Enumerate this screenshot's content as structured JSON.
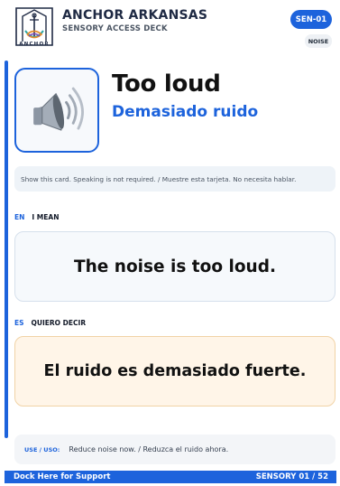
{
  "header": {
    "logo_text": "ANCHOR",
    "brand": "ANCHOR ARKANSAS",
    "deck": "SENSORY ACCESS DECK",
    "code": "SEN-01",
    "category": "NOISE"
  },
  "hero": {
    "icon": "speaker-loud-icon",
    "title": "Too loud",
    "subtitle": "Demasiado ruido"
  },
  "notice": "Show this card. Speaking is not required. / Muestre esta tarjeta. No necesita hablar.",
  "english": {
    "code": "EN",
    "label": "I MEAN",
    "phrase": "The noise is too loud."
  },
  "spanish": {
    "code": "ES",
    "label": "QUIERO DECIR",
    "phrase": "El ruido es demasiado fuerte."
  },
  "use": {
    "label": "USE / USO:",
    "text": "Reduce noise now. / Reduzca el ruido ahora."
  },
  "footer": {
    "left": "Dock Here for Support",
    "right": "SENSORY 01 / 52"
  },
  "colors": {
    "accent": "#1d63dc",
    "spanish_bg": "#fff5e8",
    "english_bg": "#f6f9fc"
  }
}
